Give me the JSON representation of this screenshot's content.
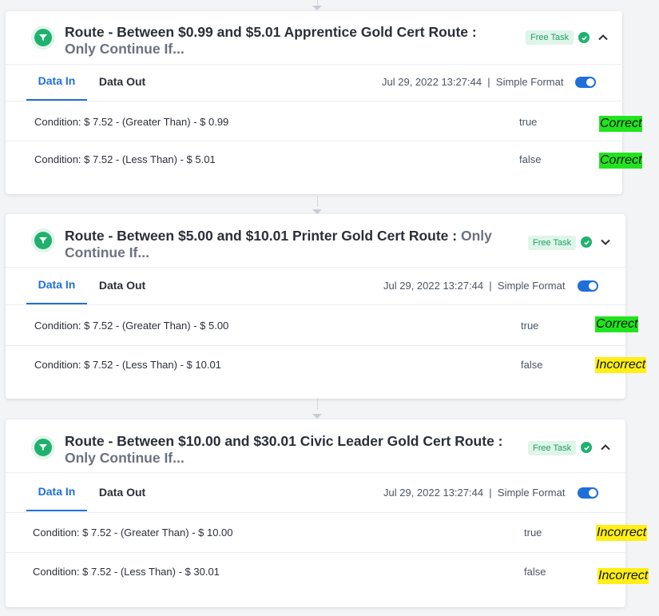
{
  "cards": [
    {
      "title_main": "Route - Between $0.99 and $5.01 Apprentice Gold Cert Route :",
      "title_sub": "Only Continue If...",
      "badge": "Free Task",
      "expand_icon": "chevron-up-icon",
      "tabs": [
        "Data In",
        "Data Out"
      ],
      "timestamp": "Jul 29, 2022 13:27:44",
      "separator": "|",
      "format_label": "Simple Format",
      "rows": [
        {
          "condition": "Condition: $ 7.52 - (Greater Than) - $ 0.99",
          "value": "true",
          "verdict": "Correct"
        },
        {
          "condition": "Condition: $ 7.52 - (Less Than) - $ 5.01",
          "value": "false",
          "verdict": "Correct"
        }
      ]
    },
    {
      "title_main": "Route - Between $5.00 and $10.01 Printer Gold Cert Route :",
      "title_inline_sub": "Only",
      "title_sub": "Continue If...",
      "badge": "Free Task",
      "expand_icon": "chevron-down-icon",
      "tabs": [
        "Data In",
        "Data Out"
      ],
      "timestamp": "Jul 29, 2022 13:27:44",
      "separator": "|",
      "format_label": "Simple Format",
      "rows": [
        {
          "condition": "Condition: $ 7.52 - (Greater Than) - $ 5.00",
          "value": "true",
          "verdict": "Correct"
        },
        {
          "condition": "Condition: $ 7.52 - (Less Than) - $ 10.01",
          "value": "false",
          "verdict": "Incorrect"
        }
      ]
    },
    {
      "title_main": "Route - Between $10.00 and $30.01 Civic Leader Gold Cert Route :",
      "title_sub": "Only Continue If...",
      "badge": "Free Task",
      "expand_icon": "chevron-up-icon",
      "tabs": [
        "Data In",
        "Data Out"
      ],
      "timestamp": "Jul 29, 2022 13:27:44",
      "separator": "|",
      "format_label": "Simple Format",
      "rows": [
        {
          "condition": "Condition: $ 7.52 - (Greater Than) - $ 10.00",
          "value": "true",
          "verdict": "Incorrect"
        },
        {
          "condition": "Condition: $ 7.52 - (Less Than) - $ 30.01",
          "value": "false",
          "verdict": "Incorrect"
        }
      ]
    }
  ],
  "colors": {
    "accent": "#1e6fd9",
    "success": "#1fb26e",
    "correct_highlight": "#21e51c",
    "incorrect_highlight": "#ffef14"
  }
}
